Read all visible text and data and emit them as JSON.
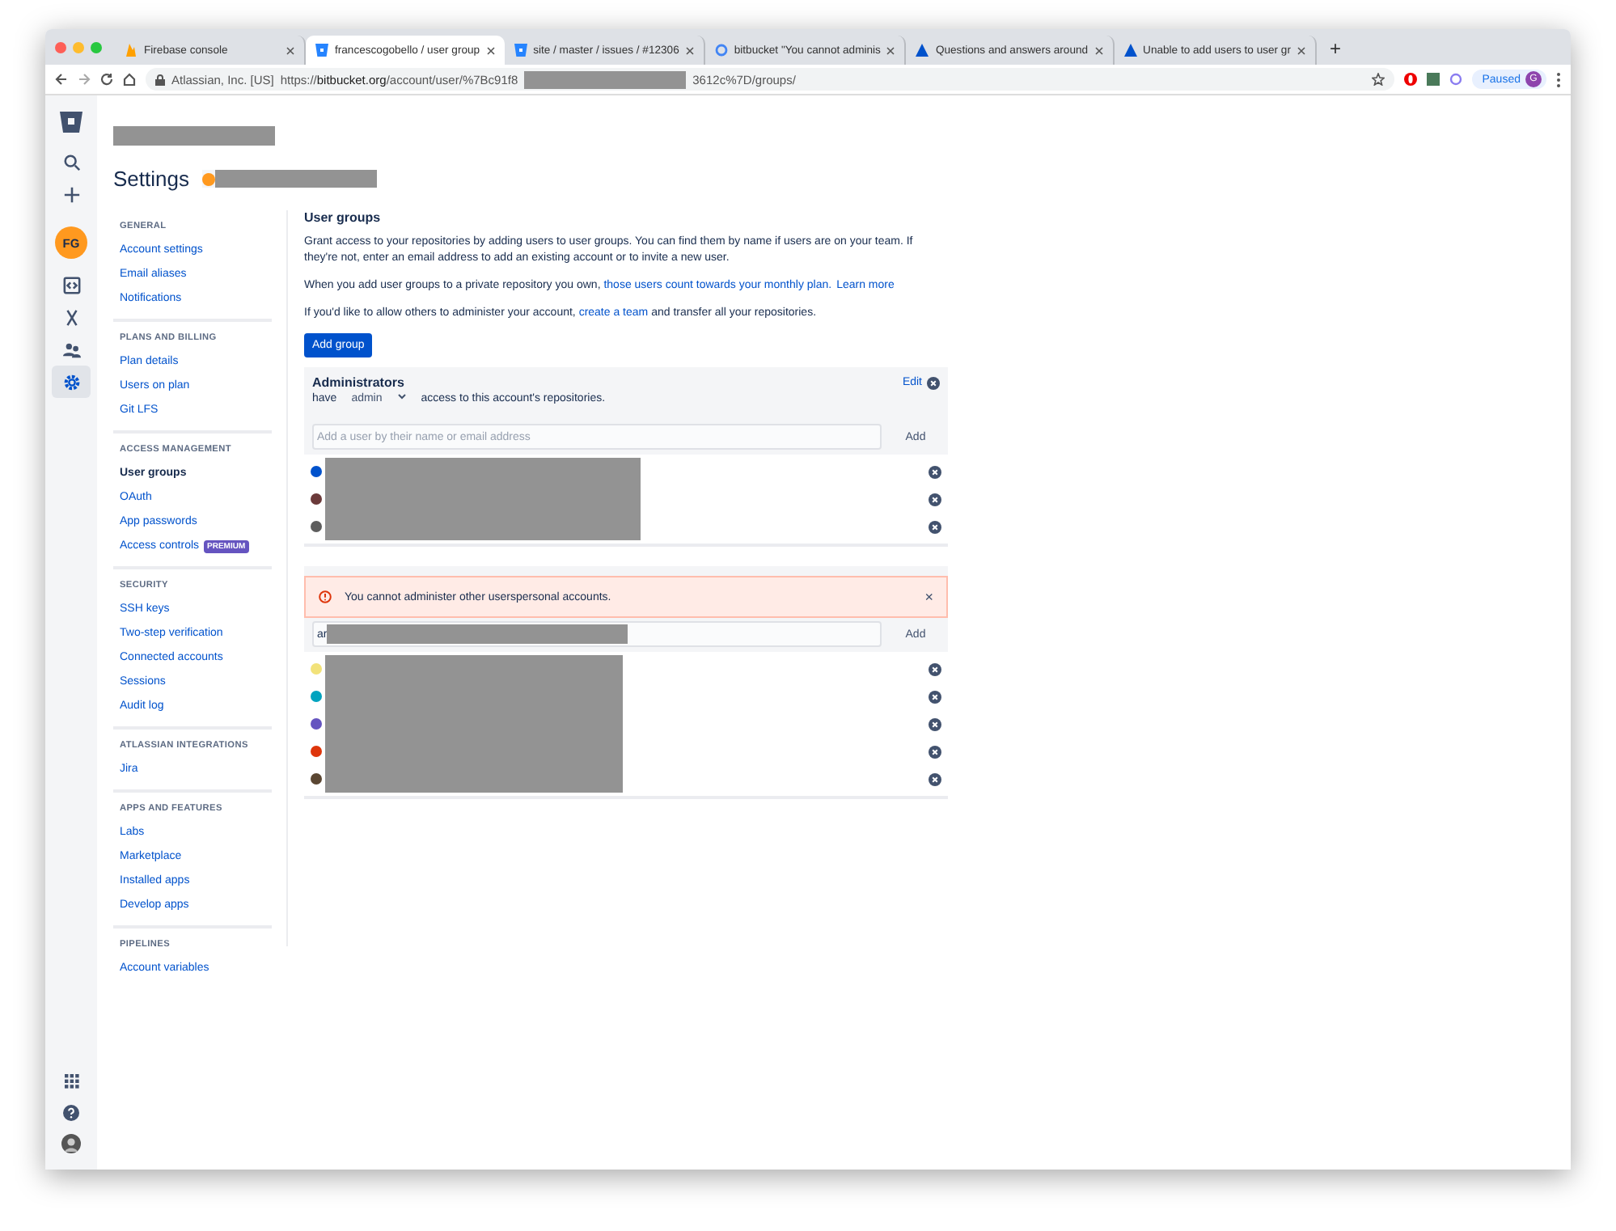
{
  "browser": {
    "tabs": [
      {
        "title": "Firebase console",
        "selected": false,
        "kind": "flame"
      },
      {
        "title": "francescogobello / user group",
        "selected": true,
        "kind": "bucket"
      },
      {
        "title": "site / master / issues / #12306",
        "selected": false,
        "kind": "bucket"
      },
      {
        "title": "bitbucket \"You cannot adminis",
        "selected": false,
        "kind": "google"
      },
      {
        "title": "Questions and answers around",
        "selected": false,
        "kind": "atlassian"
      },
      {
        "title": "Unable to add users to user gr",
        "selected": false,
        "kind": "atlassian"
      }
    ],
    "new_tab": "+",
    "address": {
      "security": "Atlassian, Inc. [US]",
      "url_scheme": "https://",
      "url_host": "bitbucket.org",
      "url_path": "/account/user/%7Bc91f8",
      "url_end": "3612c%7D/groups/"
    },
    "profile": {
      "status": "Paused",
      "initial": "G"
    }
  },
  "rail": {
    "avatar": "FG",
    "items": [
      {
        "kind": "search",
        "selected": false
      },
      {
        "kind": "create",
        "selected": false
      },
      {
        "kind": "code",
        "selected": false
      },
      {
        "kind": "merge",
        "selected": false
      },
      {
        "kind": "people",
        "selected": false
      },
      {
        "kind": "settings",
        "selected": true
      }
    ]
  },
  "header": {
    "title": "Settings"
  },
  "sidebar": {
    "sections": [
      {
        "heading": "GENERAL",
        "items": [
          {
            "label": "Account settings",
            "selected": false
          },
          {
            "label": "Email aliases",
            "selected": false
          },
          {
            "label": "Notifications",
            "selected": false
          }
        ]
      },
      {
        "heading": "PLANS AND BILLING",
        "items": [
          {
            "label": "Plan details",
            "selected": false
          },
          {
            "label": "Users on plan",
            "selected": false
          },
          {
            "label": "Git LFS",
            "selected": false
          }
        ]
      },
      {
        "heading": "ACCESS MANAGEMENT",
        "items": [
          {
            "label": "User groups",
            "selected": true
          },
          {
            "label": "OAuth",
            "selected": false
          },
          {
            "label": "App passwords",
            "selected": false
          },
          {
            "label": "Access controls",
            "selected": false,
            "badge": "PREMIUM"
          }
        ]
      },
      {
        "heading": "SECURITY",
        "items": [
          {
            "label": "SSH keys",
            "selected": false
          },
          {
            "label": "Two-step verification",
            "selected": false
          },
          {
            "label": "Connected accounts",
            "selected": false
          },
          {
            "label": "Sessions",
            "selected": false
          },
          {
            "label": "Audit log",
            "selected": false
          }
        ]
      },
      {
        "heading": "ATLASSIAN INTEGRATIONS",
        "items": [
          {
            "label": "Jira",
            "selected": false
          }
        ]
      },
      {
        "heading": "APPS AND FEATURES",
        "items": [
          {
            "label": "Labs",
            "selected": false
          },
          {
            "label": "Marketplace",
            "selected": false
          },
          {
            "label": "Installed apps",
            "selected": false
          },
          {
            "label": "Develop apps",
            "selected": false
          }
        ]
      },
      {
        "heading": "PIPELINES",
        "items": [
          {
            "label": "Account variables",
            "selected": false
          }
        ]
      }
    ]
  },
  "main": {
    "heading": "User groups",
    "paragraphs": [
      [
        {
          "kind": "text",
          "text": "Grant access to your repositories by adding users to user groups. You can find them by name if users are on your team. If they're not, enter an email address to add an existing account or to invite a new user."
        }
      ],
      [
        {
          "kind": "text",
          "text": "When you add user groups to a private repository you own, "
        },
        {
          "kind": "link",
          "text": "those users count towards your monthly plan."
        },
        {
          "kind": "link",
          "text": "Learn more"
        }
      ],
      [
        {
          "kind": "text",
          "text": "If you'd like to allow others to administer your account, "
        },
        {
          "kind": "link",
          "text": "create a team"
        },
        {
          "kind": "text",
          "text": " and transfer all your repositories."
        }
      ]
    ],
    "add_button": "Add group",
    "groups": [
      {
        "name": "Administrators",
        "have": "have",
        "permission": "admin",
        "access_text": "access to this account's repositories.",
        "edit": "Edit",
        "placeholder": "Add a user by their name or email address",
        "add": "Add",
        "members": [
          {
            "color": "#0052cc"
          },
          {
            "color": "#6b3a3a"
          },
          {
            "color": "#5e5e5e"
          }
        ]
      },
      {
        "error": {
          "message": "You cannot administer other userspersonal accounts.",
          "dismiss": "×"
        },
        "value": "ar",
        "add": "Add",
        "members": [
          {
            "color": "#f2e27a"
          },
          {
            "color": "#00a3bf"
          },
          {
            "color": "#6554c0"
          },
          {
            "color": "#de350b"
          },
          {
            "color": "#5a4632"
          }
        ]
      }
    ]
  }
}
